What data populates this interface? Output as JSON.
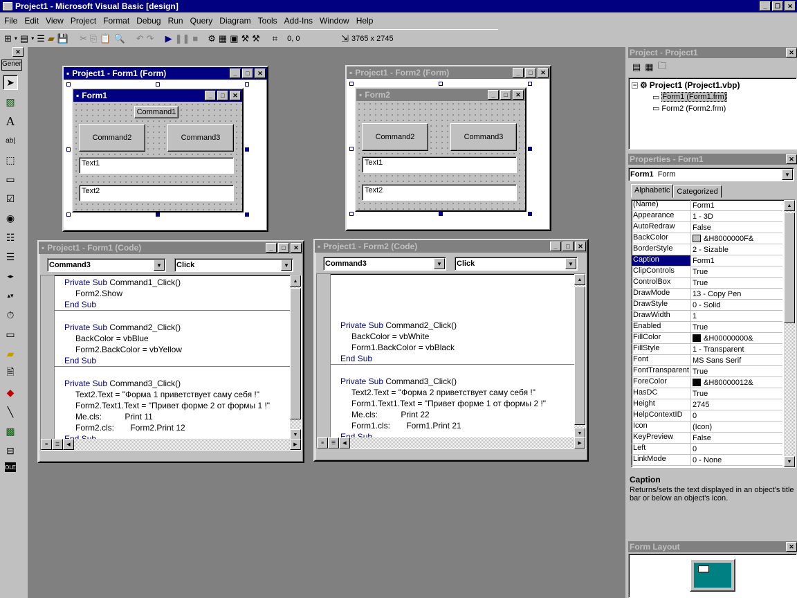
{
  "app": {
    "title": "Project1 - Microsoft Visual Basic [design]"
  },
  "menu": [
    "File",
    "Edit",
    "View",
    "Project",
    "Format",
    "Debug",
    "Run",
    "Query",
    "Diagram",
    "Tools",
    "Add-Ins",
    "Window",
    "Help"
  ],
  "toolbar": {
    "position": "0, 0",
    "size": "3765 x 2745"
  },
  "toolbox": {
    "tab_label": "General"
  },
  "form1_designer": {
    "title": "Project1 - Form1 (Form)",
    "form_caption": "Form1",
    "buttons": [
      "Command1",
      "Command2",
      "Command3"
    ],
    "textboxes": [
      "Text1",
      "Text2"
    ]
  },
  "form2_designer": {
    "title": "Project1 - Form2 (Form)",
    "form_caption": "Form2",
    "buttons": [
      "Command2",
      "Command3"
    ],
    "textboxes": [
      "Text1",
      "Text2"
    ]
  },
  "code1": {
    "title": "Project1 - Form1 (Code)",
    "object": "Command3",
    "procedure": "Click",
    "sections": [
      [
        {
          "indent": 0,
          "text": "Private Sub Command1_Click()"
        },
        {
          "indent": 1,
          "text": "Form2.Show"
        },
        {
          "indent": 0,
          "text": "End Sub"
        }
      ],
      [
        {
          "indent": 0,
          "text": "Private Sub Command2_Click()"
        },
        {
          "indent": 1,
          "text": "BackColor = vbBlue"
        },
        {
          "indent": 1,
          "text": "Form2.BackColor = vbYellow"
        },
        {
          "indent": 0,
          "text": "End Sub"
        }
      ],
      [
        {
          "indent": 0,
          "text": "Private Sub Command3_Click()"
        },
        {
          "indent": 1,
          "text": "Text2.Text = \"Форма 1 приветствует саму себя !\""
        },
        {
          "indent": 1,
          "text": "Form2.Text1.Text = \"Привет форме 2 от формы 1 !\""
        },
        {
          "indent": 1,
          "text": "Me.cls:          Print 11"
        },
        {
          "indent": 1,
          "text": "Form2.cls:       Form2.Print 12"
        },
        {
          "indent": 0,
          "text": "End Sub"
        }
      ]
    ]
  },
  "code2": {
    "title": "Project1 - Form2 (Code)",
    "object": "Command3",
    "procedure": "Click",
    "sections": [
      [
        {
          "indent": 0,
          "text": "Private Sub Command2_Click()"
        },
        {
          "indent": 1,
          "text": "BackColor = vbWhite"
        },
        {
          "indent": 1,
          "text": "Form1.BackColor = vbBlack"
        },
        {
          "indent": 0,
          "text": "End Sub"
        }
      ],
      [
        {
          "indent": 0,
          "text": "Private Sub Command3_Click()"
        },
        {
          "indent": 1,
          "text": "Text2.Text = \"Форма 2 приветствует саму себя !\""
        },
        {
          "indent": 1,
          "text": "Form1.Text1.Text = \"Привет форме 1 от формы 2 !\""
        },
        {
          "indent": 1,
          "text": "Me.cls:          Print 22"
        },
        {
          "indent": 1,
          "text": "Form1.cls:       Form1.Print 21"
        },
        {
          "indent": 0,
          "text": "End Sub"
        }
      ]
    ]
  },
  "project": {
    "title": "Project - Project1",
    "root": "Project1 (Project1.vbp)",
    "items": [
      "Form1 (Form1.frm)",
      "Form2 (Form2.frm)"
    ]
  },
  "properties": {
    "title": "Properties - Form1",
    "object_name": "Form1",
    "object_type": "Form",
    "tabs": [
      "Alphabetic",
      "Categorized"
    ],
    "rows": [
      {
        "name": "(Name)",
        "value": "Form1"
      },
      {
        "name": "Appearance",
        "value": "1 - 3D"
      },
      {
        "name": "AutoRedraw",
        "value": "False"
      },
      {
        "name": "BackColor",
        "value": "&H8000000F&",
        "swatch": "#c0c0c0"
      },
      {
        "name": "BorderStyle",
        "value": "2 - Sizable"
      },
      {
        "name": "Caption",
        "value": "Form1",
        "selected": true
      },
      {
        "name": "ClipControls",
        "value": "True"
      },
      {
        "name": "ControlBox",
        "value": "True"
      },
      {
        "name": "DrawMode",
        "value": "13 - Copy Pen"
      },
      {
        "name": "DrawStyle",
        "value": "0 - Solid"
      },
      {
        "name": "DrawWidth",
        "value": "1"
      },
      {
        "name": "Enabled",
        "value": "True"
      },
      {
        "name": "FillColor",
        "value": "&H00000000&",
        "swatch": "#000000"
      },
      {
        "name": "FillStyle",
        "value": "1 - Transparent"
      },
      {
        "name": "Font",
        "value": "MS Sans Serif"
      },
      {
        "name": "FontTransparent",
        "value": "True"
      },
      {
        "name": "ForeColor",
        "value": "&H80000012&",
        "swatch": "#000000"
      },
      {
        "name": "HasDC",
        "value": "True"
      },
      {
        "name": "Height",
        "value": "2745"
      },
      {
        "name": "HelpContextID",
        "value": "0"
      },
      {
        "name": "Icon",
        "value": "(Icon)"
      },
      {
        "name": "KeyPreview",
        "value": "False"
      },
      {
        "name": "Left",
        "value": "0"
      },
      {
        "name": "LinkMode",
        "value": "0 - None"
      }
    ],
    "desc_title": "Caption",
    "desc_text": "Returns/sets the text displayed in an object's title bar or below an object's icon."
  },
  "form_layout": {
    "title": "Form Layout"
  }
}
